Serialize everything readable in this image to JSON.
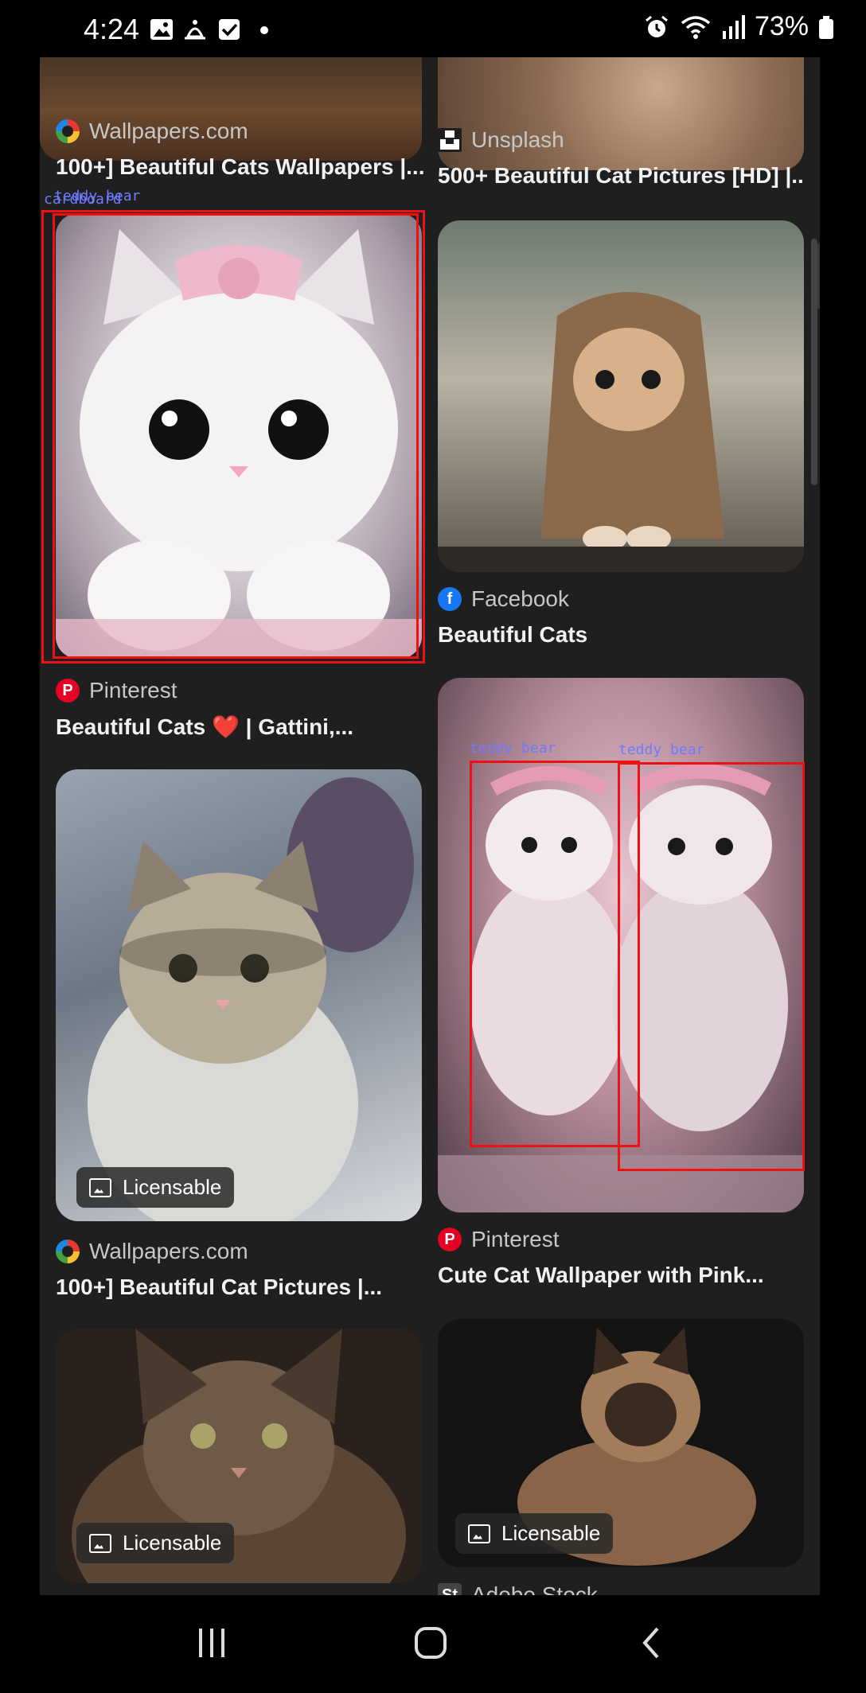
{
  "status": {
    "time": "4:24",
    "battery": "73%"
  },
  "cards": [
    {
      "source": "Wallpapers.com",
      "title": "100+] Beautiful Cats Wallpapers |..."
    },
    {
      "source": "Unsplash",
      "title": "500+ Beautiful Cat Pictures [HD] |..."
    },
    {
      "source": "Facebook",
      "title": "Beautiful Cats"
    },
    {
      "source": "Pinterest",
      "title": "Beautiful Cats ❤️ | Gattini,..."
    },
    {
      "source": "Pinterest",
      "title": "Cute Cat Wallpaper with Pink..."
    },
    {
      "source": "Wallpapers.com",
      "title": "100+] Beautiful Cat Pictures |...",
      "badge": "Licensable"
    },
    {
      "source": "Adobe Stock",
      "title": "",
      "badge": "Licensable"
    },
    {
      "badge": "Licensable"
    }
  ],
  "annotations": [
    {
      "label": "cardboard"
    },
    {
      "label": "teddy bear"
    },
    {
      "label": "teddy bear"
    },
    {
      "label": "teddy bear"
    }
  ],
  "colors": {
    "background": "#1f1f1f",
    "annotation_box": "#e11111",
    "annotation_text": "#6f7bff"
  }
}
